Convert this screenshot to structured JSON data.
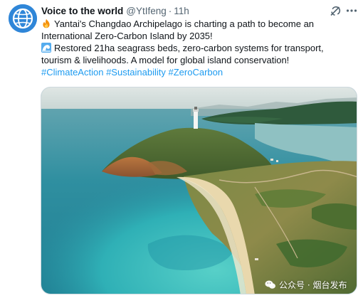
{
  "author": {
    "display_name": "Voice to the world",
    "handle": "@YtIfeng",
    "separator": "·",
    "timestamp": "11h"
  },
  "icons": {
    "avatar": "globe-avatar",
    "grok": "grok-icon",
    "more": "more-icon",
    "fire": "fire-emoji",
    "wave": "wave-emoji"
  },
  "tweet": {
    "line1": "Yantai's Changdao Archipelago is charting a path to become an",
    "line2": "International Zero-Carbon Island by 2035!",
    "line3": "Restored 21ha seagrass beds, zero-carbon systems for transport,",
    "line4": "tourism & livelihoods. A model for global island conservation!",
    "hashtags": [
      "#ClimateAction",
      "#Sustainability",
      "#ZeroCarbon"
    ]
  },
  "media": {
    "watermark": "公众号 · 烟台发布"
  },
  "colors": {
    "link": "#1d9bf0",
    "text": "#0f1419",
    "muted": "#536471"
  }
}
